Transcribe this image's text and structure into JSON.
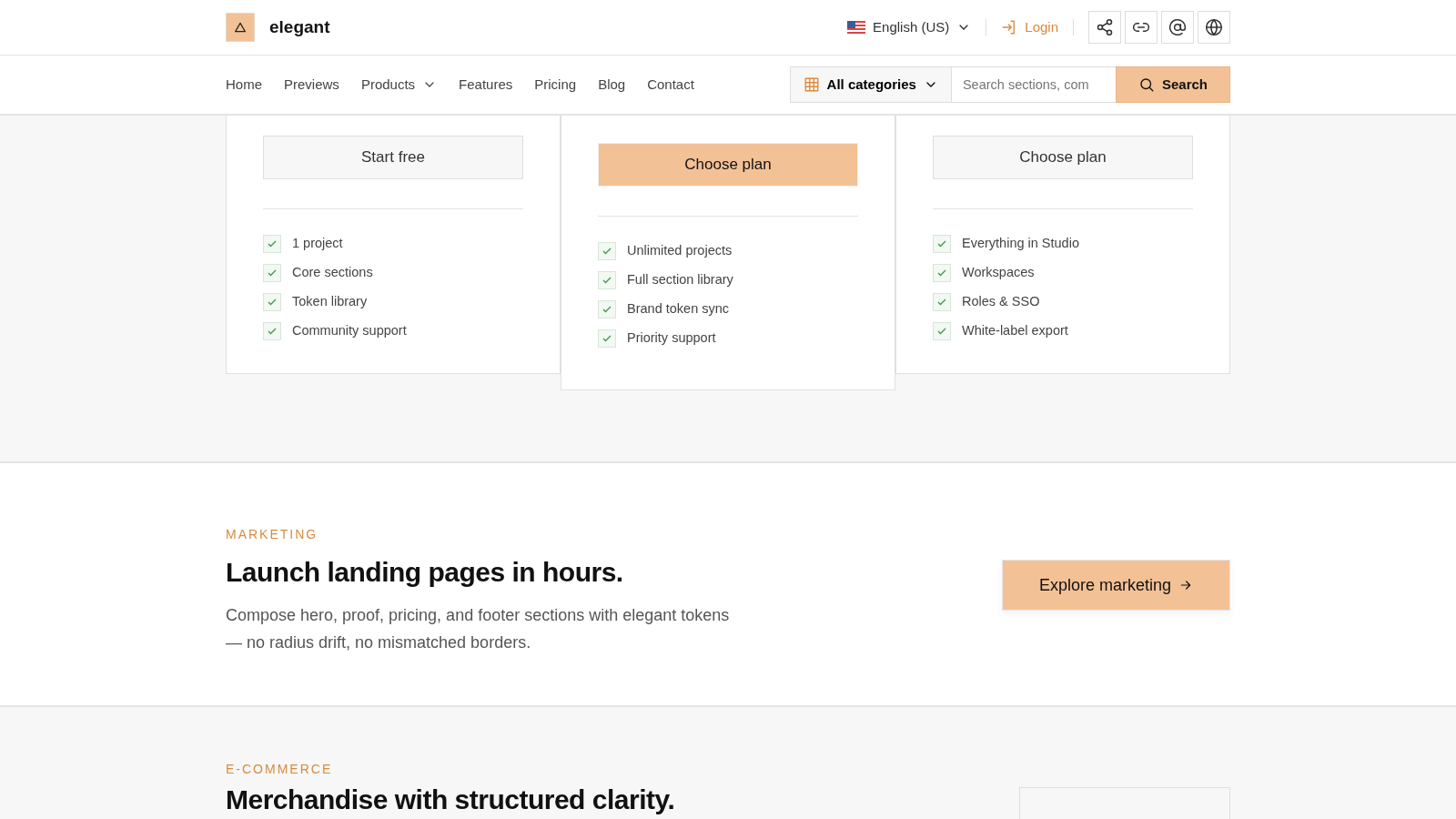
{
  "brand": {
    "name": "elegant"
  },
  "top_bar": {
    "language": "English (US)",
    "login": "Login",
    "icon_buttons": [
      {
        "kind": "share"
      },
      {
        "kind": "link"
      },
      {
        "kind": "at"
      },
      {
        "kind": "globe"
      }
    ]
  },
  "nav": {
    "items": [
      {
        "label": "Home",
        "dropdown": false
      },
      {
        "label": "Previews",
        "dropdown": false
      },
      {
        "label": "Products",
        "dropdown": true
      },
      {
        "label": "Features",
        "dropdown": false
      },
      {
        "label": "Pricing",
        "dropdown": false
      },
      {
        "label": "Blog",
        "dropdown": false
      },
      {
        "label": "Contact",
        "dropdown": false
      }
    ],
    "category": "All categories",
    "search": {
      "placeholder": "Search sections, com",
      "button": "Search"
    }
  },
  "plans": [
    {
      "featured": false,
      "button": "Start free",
      "features": [
        "1 project",
        "Core sections",
        "Token library",
        "Community support"
      ]
    },
    {
      "featured": true,
      "button": "Choose plan",
      "features": [
        "Unlimited projects",
        "Full section library",
        "Brand token sync",
        "Priority support"
      ]
    },
    {
      "featured": false,
      "button": "Choose plan",
      "features": [
        "Everything in Studio",
        "Workspaces",
        "Roles & SSO",
        "White-label export"
      ]
    }
  ],
  "sections": [
    {
      "eyebrow": "MARKETING",
      "title": "Launch landing pages in hours.",
      "text": "Compose hero, proof, pricing, and footer sections with elegant tokens — no radius drift, no mismatched borders.",
      "button": "Explore marketing"
    },
    {
      "eyebrow": "E-COMMERCE",
      "title": "Merchandise with structured clarity."
    }
  ]
}
